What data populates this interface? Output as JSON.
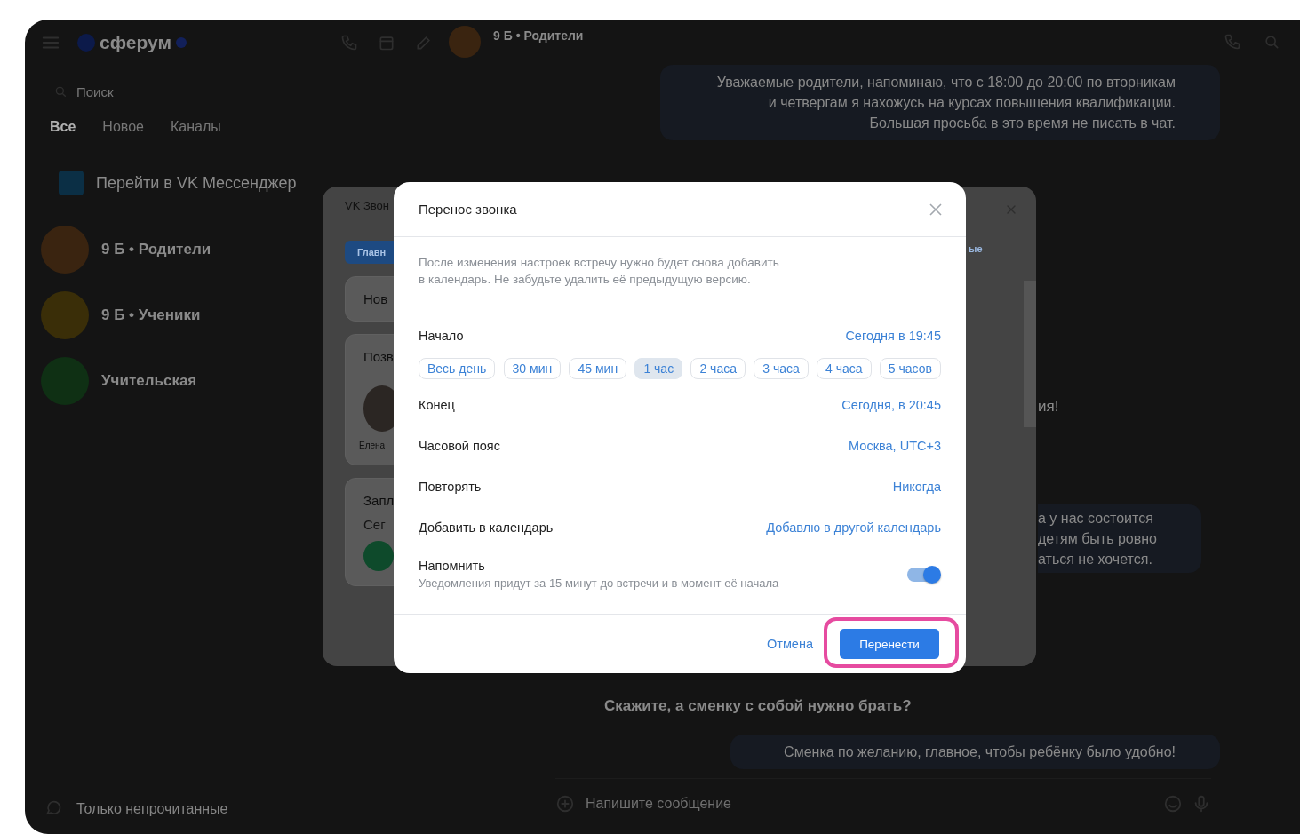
{
  "sidebar": {
    "logo": "сферум",
    "search": {
      "placeholder": "Поиск"
    },
    "tabs": [
      {
        "label": "Все",
        "selected": true
      },
      {
        "label": "Новое",
        "selected": false
      },
      {
        "label": "Каналы",
        "selected": false
      }
    ],
    "promo": "Перейти в VK Мессенджер",
    "chats": [
      {
        "name": "9 Б • Родители",
        "color": "#3a2410"
      },
      {
        "name": "9 Б • Ученики",
        "color": "#3a2e08"
      },
      {
        "name": "Учительская",
        "color": "#0f3014"
      }
    ],
    "footer": "Только непрочитанные"
  },
  "chat": {
    "title": "9 Б • Родители",
    "messages": [
      {
        "kind": "outgoing",
        "text": "Уважаемые родители, напоминаю, что с 18:00 до 20:00 по вторникам и четвергам я нахожусь на курсах повышения квалификации. Большая просьба в это время не писать в чат."
      },
      {
        "kind": "fragment",
        "text": "ия!"
      },
      {
        "kind": "fragment-bubble",
        "text": "а у нас состоится\nдетям быть ровно\nаться не хочется."
      },
      {
        "kind": "incoming",
        "text": "Скажите, а сменку с собой нужно брать?"
      },
      {
        "kind": "outgoing",
        "text": "Сменка по желанию, главное, чтобы ребёнку было удобно!"
      }
    ],
    "composer": {
      "placeholder": "Напишите сообщение"
    }
  },
  "calls_window": {
    "title": "VK Звон",
    "tab": "Главн",
    "cards": [
      "Нов",
      "Позв",
      "Запл"
    ],
    "person": "Елена",
    "date": "Сег",
    "side_link": "ые"
  },
  "dialog": {
    "title": "Перенос звонка",
    "note": "После изменения настроек встречу нужно будет снова добавить\nв календарь. Не забудьте удалить её предыдущую версию.",
    "start": {
      "label": "Начало",
      "value": "Сегодня в 19:45"
    },
    "durations": [
      {
        "label": "Весь день",
        "selected": false
      },
      {
        "label": "30 мин",
        "selected": false
      },
      {
        "label": "45 мин",
        "selected": false
      },
      {
        "label": "1 час",
        "selected": true
      },
      {
        "label": "2 часа",
        "selected": false
      },
      {
        "label": "3 часа",
        "selected": false
      },
      {
        "label": "4 часа",
        "selected": false
      },
      {
        "label": "5 часов",
        "selected": false
      }
    ],
    "rows": [
      {
        "label": "Конец",
        "value": "Сегодня, в 20:45"
      },
      {
        "label": "Часовой пояс",
        "value": "Москва, UTC+3"
      },
      {
        "label": "Повторять",
        "value": "Никогда"
      },
      {
        "label": "Добавить в календарь",
        "value": "Добавлю в другой календарь"
      }
    ],
    "remind": {
      "label": "Напомнить",
      "hint": "Уведомления придут за 15 минут до встречи и в момент её начала",
      "on": true
    },
    "cancel": "Отмена",
    "confirm": "Перенести",
    "confirm_highlighted": true
  }
}
